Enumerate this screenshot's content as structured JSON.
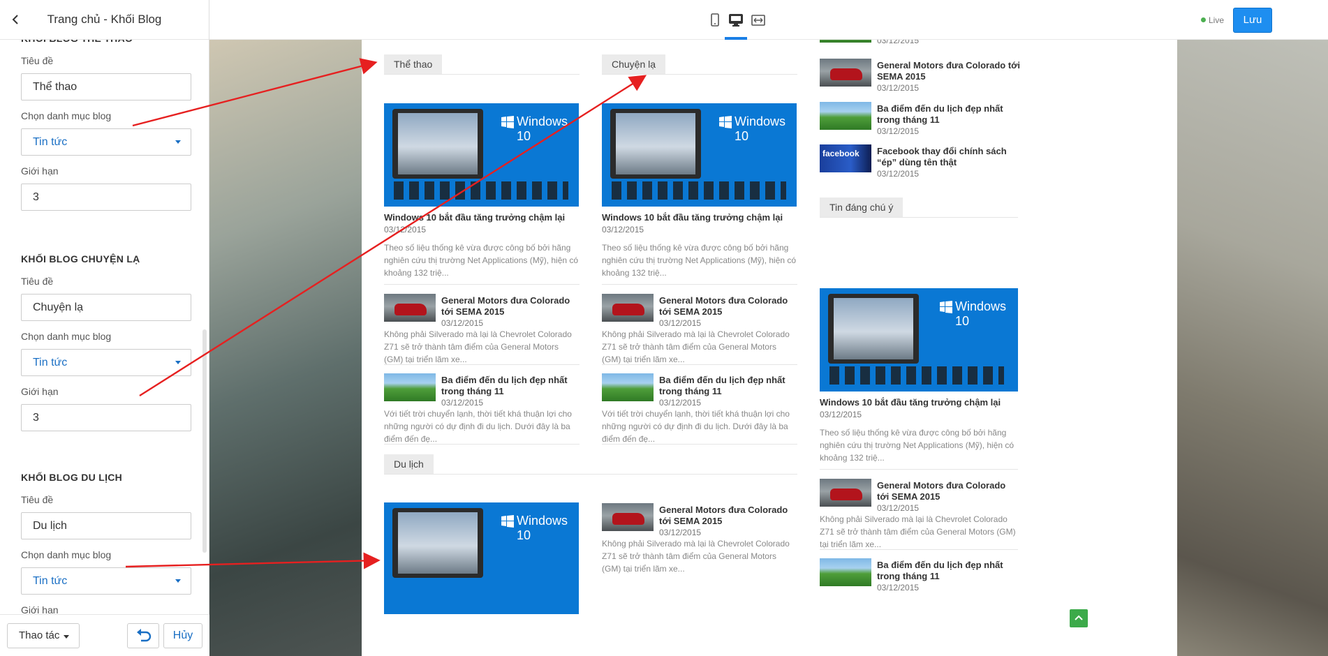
{
  "sidebar": {
    "title": "Trang chủ - Khối Blog",
    "blocks": [
      {
        "title": "KHỐI BLOG THỂ THAO",
        "label_title": "Tiêu đề",
        "title_value": "Thể thao",
        "label_category": "Chọn danh mục blog",
        "category_value": "Tin tức",
        "label_limit": "Giới hạn",
        "limit_value": "3"
      },
      {
        "title": "KHỐI BLOG CHUYỆN LẠ",
        "label_title": "Tiêu đề",
        "title_value": "Chuyện lạ",
        "label_category": "Chọn danh mục blog",
        "category_value": "Tin tức",
        "label_limit": "Giới hạn",
        "limit_value": "3"
      },
      {
        "title": "KHỐI BLOG DU LỊCH",
        "label_title": "Tiêu đề",
        "title_value": "Du lịch",
        "label_category": "Chọn danh mục blog",
        "category_value": "Tin tức",
        "label_limit": "Giới hạn"
      }
    ],
    "footer": {
      "actions_label": "Thao tác",
      "cancel_label": "Hủy"
    }
  },
  "topbar": {
    "live_label": "Live",
    "save_label": "Lưu"
  },
  "preview": {
    "tags": {
      "sport": "Thể thao",
      "strange": "Chuyện lạ",
      "travel": "Du lịch",
      "featured": "Tin đáng chú ý"
    },
    "posts": {
      "win_title": "Windows 10 bắt đầu tăng trưởng chậm lại",
      "win_excerpt": "Theo số liệu thống kê vừa được công bố bởi hãng nghiên cứu thị trường Net Applications (Mỹ), hiện có khoảng 132 triệ...",
      "gm_title": "General Motors đưa Colorado tới SEMA 2015",
      "gm_excerpt": "Không phải Silverado mà lại là Chevrolet Colorado Z71 sẽ trở thành tâm điểm của General Motors (GM) tại triển lãm xe...",
      "travel_title": "Ba điểm đến du lịch đẹp nhất trong tháng 11",
      "travel_excerpt": "Với tiết trời chuyển lạnh, thời tiết khá thuận lợi cho những người có dự định đi du lịch. Dưới đây là ba điểm đến đẹ...",
      "fb_title": "Facebook thay đổi chính sách “ép” dùng tên thật",
      "date": "03/12/2015",
      "win_logo": "Windows 10",
      "fb_logo": "facebook"
    }
  }
}
